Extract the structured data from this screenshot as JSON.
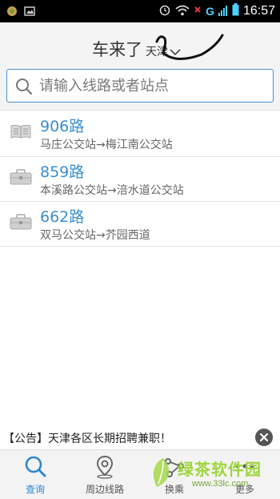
{
  "status_bar": {
    "time": "16:57",
    "network": "G"
  },
  "header": {
    "title": "车来了",
    "city": "天津"
  },
  "search": {
    "placeholder": "请输入线路或者站点"
  },
  "routes": [
    {
      "number": "906路",
      "direction": "马庄公交站→梅江南公交站",
      "icon": "book-icon"
    },
    {
      "number": "859路",
      "direction": "本溪路公交站→涪水道公交站",
      "icon": "briefcase-icon"
    },
    {
      "number": "662路",
      "direction": "双马公交站→芥园西道",
      "icon": "briefcase-icon"
    }
  ],
  "notice": {
    "text": "【公告】天津各区长期招聘兼职！"
  },
  "bottom_nav": [
    {
      "label": "查询",
      "icon": "search-icon",
      "active": true
    },
    {
      "label": "周边线路",
      "icon": "location-pin-icon",
      "active": false
    },
    {
      "label": "换乘",
      "icon": "transfer-icon",
      "active": false
    },
    {
      "label": "更多",
      "icon": "more-icon",
      "active": false
    }
  ],
  "watermark": {
    "text": "绿茶软件园",
    "url": "www.33lc.com"
  },
  "colors": {
    "accent": "#3a8fd0",
    "status_bar": "#000000",
    "header_bg": "#f4f4f4"
  }
}
